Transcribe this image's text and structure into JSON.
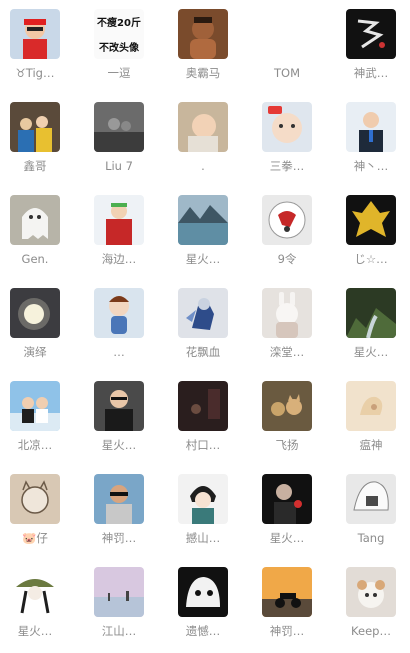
{
  "contacts": [
    {
      "name": "♉Tig…",
      "avatar_icon": "boy-red-outfit-icon"
    },
    {
      "name": "一逗",
      "avatar_icon": "text-avatar",
      "avatar_text": [
        "不瘦20斤",
        "不改头像"
      ]
    },
    {
      "name": "奥霸马",
      "avatar_icon": "cartoon-man-icon"
    },
    {
      "name": "TOM",
      "avatar_icon": "blank-avatar"
    },
    {
      "name": "神武…",
      "avatar_icon": "calligraphy-icon"
    },
    {
      "name": "鑫哥",
      "avatar_icon": "group-photo-icon"
    },
    {
      "name": "Liu  7",
      "avatar_icon": "bw-photo-icon"
    },
    {
      "name": ".",
      "avatar_icon": "baby-photo-icon"
    },
    {
      "name": "三拳…",
      "avatar_icon": "baby-face-icon"
    },
    {
      "name": "神丶…",
      "avatar_icon": "man-suit-icon"
    },
    {
      "name": "Gen.",
      "avatar_icon": "ghost-icon"
    },
    {
      "name": "海边…",
      "avatar_icon": "anime-character-icon"
    },
    {
      "name": "星火…",
      "avatar_icon": "lake-landscape-icon"
    },
    {
      "name": "9令",
      "avatar_icon": "round-logo-icon"
    },
    {
      "name": "じ☆…",
      "avatar_icon": "golden-warrior-icon"
    },
    {
      "name": "演绎",
      "avatar_icon": "light-sphere-icon"
    },
    {
      "name": "…",
      "avatar_icon": "chibi-boy-icon"
    },
    {
      "name": "花飘血",
      "avatar_icon": "game-hero-icon"
    },
    {
      "name": "滦堂…",
      "avatar_icon": "rabbit-doll-icon"
    },
    {
      "name": "星火…",
      "avatar_icon": "forest-stream-icon"
    },
    {
      "name": "北凉…",
      "avatar_icon": "kids-beach-icon"
    },
    {
      "name": "星火…",
      "avatar_icon": "man-glasses-icon"
    },
    {
      "name": "村口…",
      "avatar_icon": "dark-room-icon"
    },
    {
      "name": "飞扬",
      "avatar_icon": "cats-icon"
    },
    {
      "name": "瘟神",
      "avatar_icon": "beige-sculpture-icon"
    },
    {
      "name": "🐷仔",
      "avatar_icon": "sketch-cat-icon"
    },
    {
      "name": "神罚…",
      "avatar_icon": "man-sunglasses-icon"
    },
    {
      "name": "撼山…",
      "avatar_icon": "anime-boy-icon"
    },
    {
      "name": "星火…",
      "avatar_icon": "man-rose-icon"
    },
    {
      "name": "Tang",
      "avatar_icon": "white-hair-icon"
    },
    {
      "name": "星火…",
      "avatar_icon": "straw-hat-girl-icon"
    },
    {
      "name": "江山…",
      "avatar_icon": "pastel-sea-icon"
    },
    {
      "name": "遗憾…",
      "avatar_icon": "manga-face-icon"
    },
    {
      "name": "神罚…",
      "avatar_icon": "sunset-motorbike-icon"
    },
    {
      "name": "Keep…",
      "avatar_icon": "cute-dog-icon"
    }
  ]
}
